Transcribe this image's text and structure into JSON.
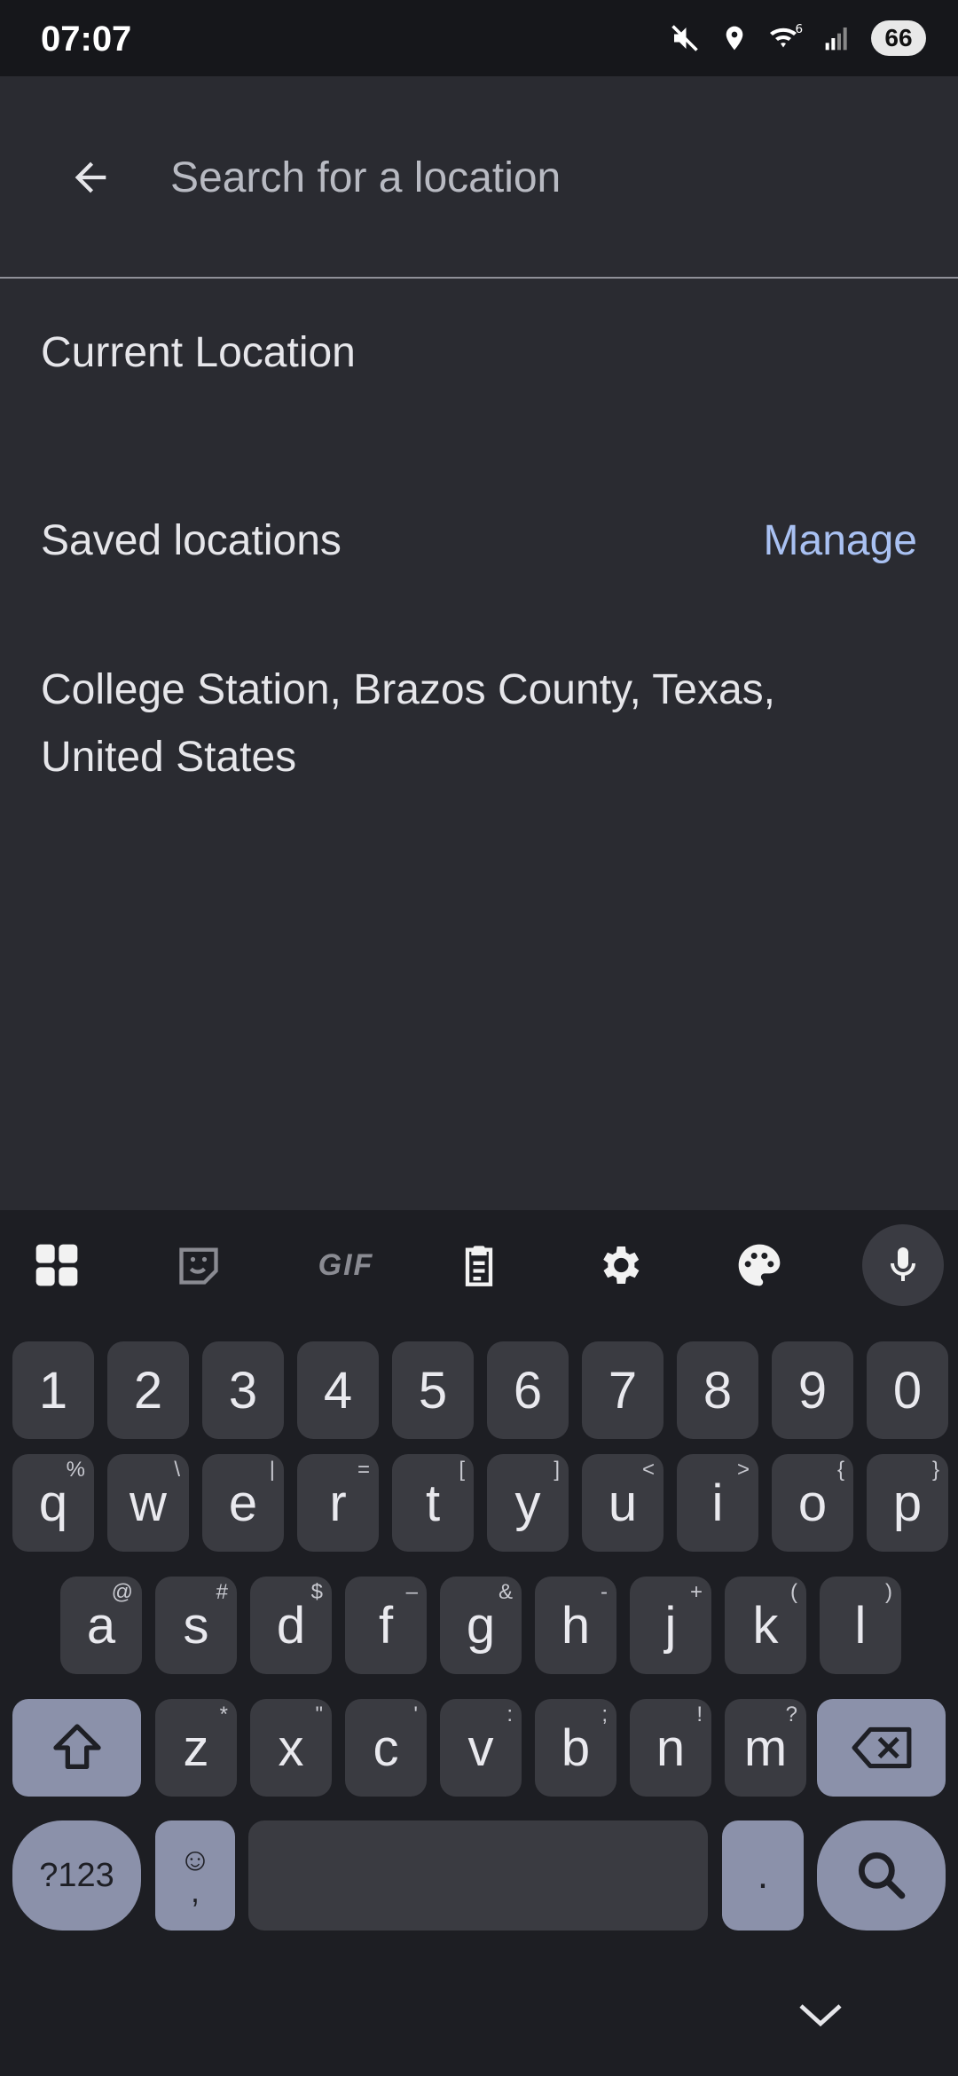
{
  "status_bar": {
    "time": "07:07",
    "battery": "66"
  },
  "search": {
    "placeholder": "Search for a location",
    "value": ""
  },
  "current_location_label": "Current Location",
  "saved_locations": {
    "header": "Saved locations",
    "manage_label": "Manage",
    "items": [
      "College Station, Brazos County, Texas, United States"
    ]
  },
  "keyboard": {
    "toolbar_icons": [
      "apps-grid-icon",
      "sticker-icon",
      "gif-icon",
      "clipboard-icon",
      "gear-icon",
      "palette-icon",
      "microphone-icon"
    ],
    "gif_label": "GIF",
    "number_row": [
      "1",
      "2",
      "3",
      "4",
      "5",
      "6",
      "7",
      "8",
      "9",
      "0"
    ],
    "row1": [
      {
        "k": "q",
        "s": "%"
      },
      {
        "k": "w",
        "s": "\\"
      },
      {
        "k": "e",
        "s": "|"
      },
      {
        "k": "r",
        "s": "="
      },
      {
        "k": "t",
        "s": "["
      },
      {
        "k": "y",
        "s": "]"
      },
      {
        "k": "u",
        "s": "<"
      },
      {
        "k": "i",
        "s": ">"
      },
      {
        "k": "o",
        "s": "{"
      },
      {
        "k": "p",
        "s": "}"
      }
    ],
    "row2": [
      {
        "k": "a",
        "s": "@"
      },
      {
        "k": "s",
        "s": "#"
      },
      {
        "k": "d",
        "s": "$"
      },
      {
        "k": "f",
        "s": "–"
      },
      {
        "k": "g",
        "s": "&"
      },
      {
        "k": "h",
        "s": "-"
      },
      {
        "k": "j",
        "s": "+"
      },
      {
        "k": "k",
        "s": "("
      },
      {
        "k": "l",
        "s": ")"
      }
    ],
    "row3": [
      {
        "k": "z",
        "s": "*"
      },
      {
        "k": "x",
        "s": "\""
      },
      {
        "k": "c",
        "s": "'"
      },
      {
        "k": "v",
        "s": ":"
      },
      {
        "k": "b",
        "s": ";"
      },
      {
        "k": "n",
        "s": "!"
      },
      {
        "k": "m",
        "s": "?"
      }
    ],
    "symbols_label": "?123",
    "emoji_label": "☺",
    "comma_label": ",",
    "period_label": ".",
    "accent_color": "#8b91aa"
  }
}
